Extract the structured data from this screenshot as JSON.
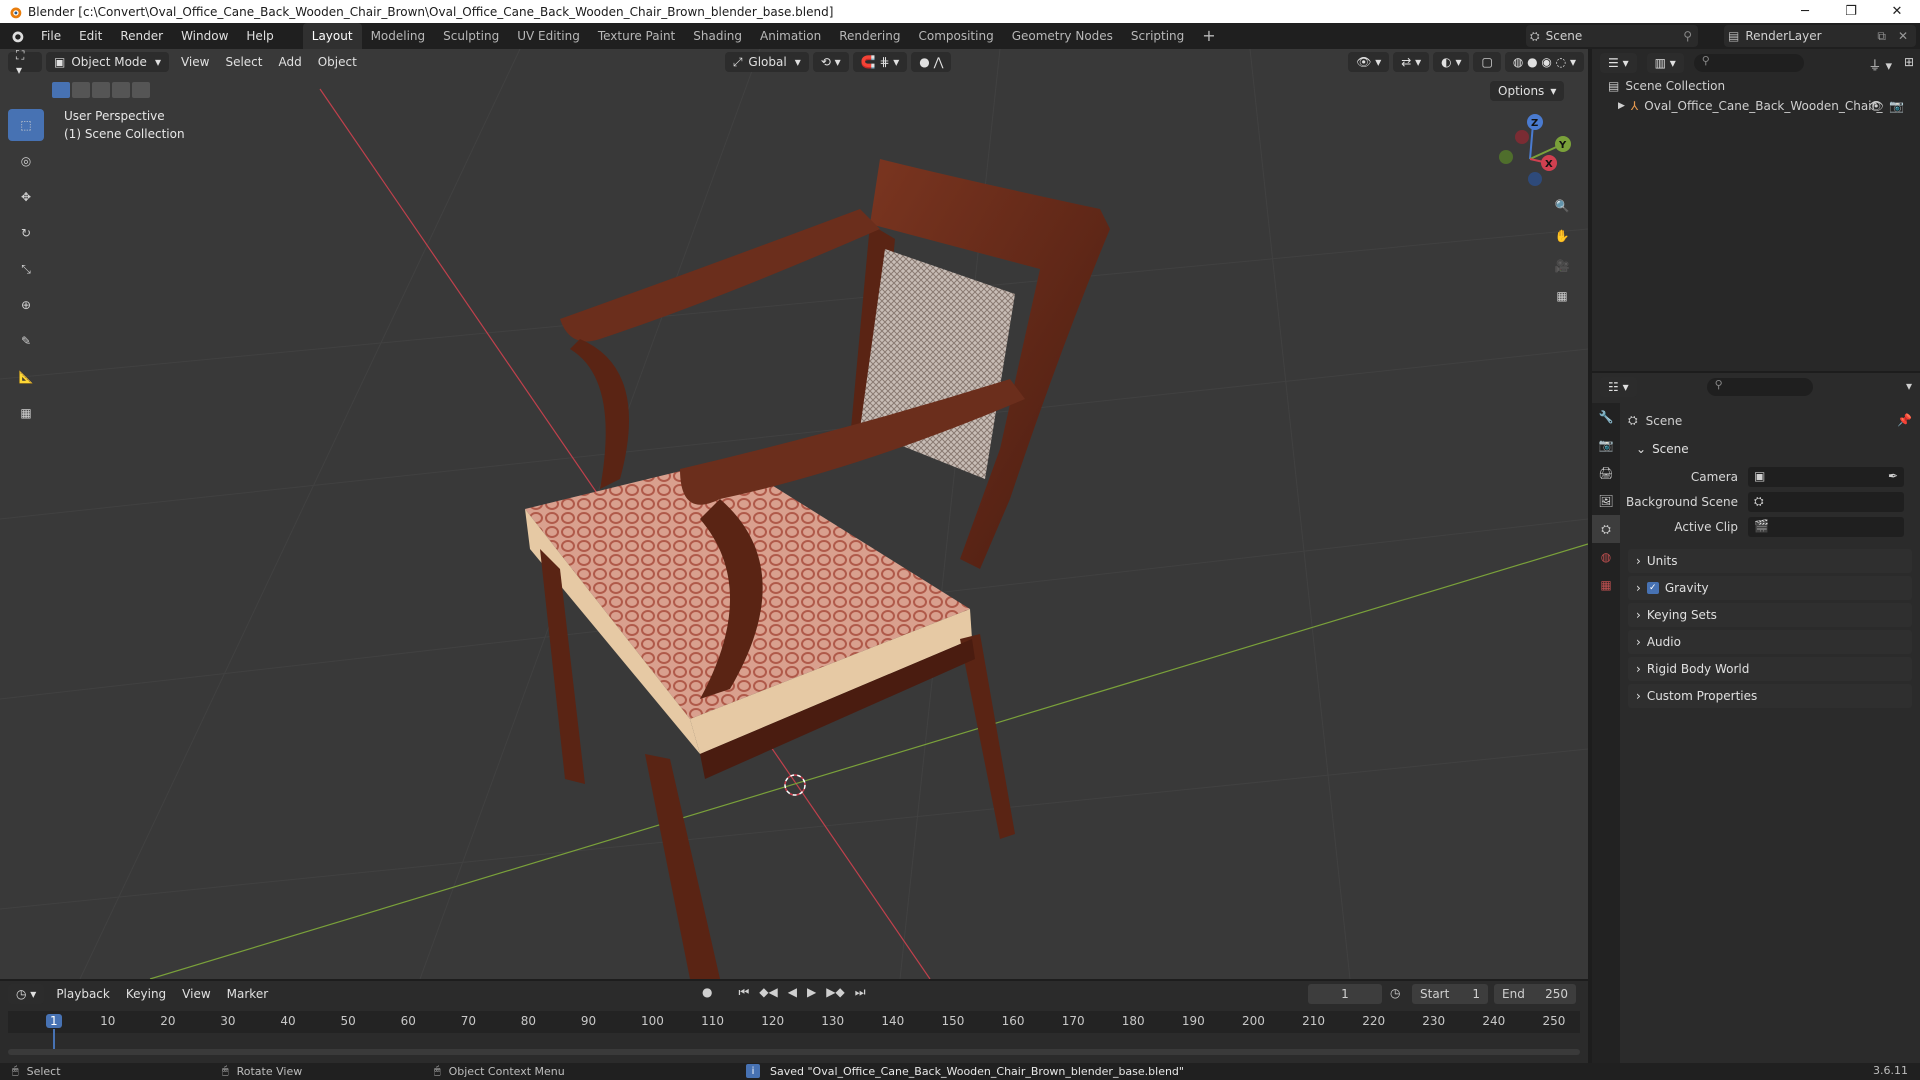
{
  "window": {
    "title": "Blender [c:\\Convert\\Oval_Office_Cane_Back_Wooden_Chair_Brown\\Oval_Office_Cane_Back_Wooden_Chair_Brown_blender_base.blend]"
  },
  "menu": [
    "File",
    "Edit",
    "Render",
    "Window",
    "Help"
  ],
  "workspaces": [
    "Layout",
    "Modeling",
    "Sculpting",
    "UV Editing",
    "Texture Paint",
    "Shading",
    "Animation",
    "Rendering",
    "Compositing",
    "Geometry Nodes",
    "Scripting"
  ],
  "active_workspace": "Layout",
  "scene_name": "Scene",
  "render_layer": "RenderLayer",
  "viewport": {
    "mode": "Object Mode",
    "menus": [
      "View",
      "Select",
      "Add",
      "Object"
    ],
    "transform_orientation": "Global",
    "options_label": "Options",
    "perspective_label": "User Perspective",
    "collection_label": "(1) Scene Collection"
  },
  "outliner": {
    "root": "Scene Collection",
    "object": "Oval_Office_Cane_Back_Wooden_Chair_"
  },
  "properties": {
    "header": "Scene",
    "panel_title": "Scene",
    "fields": [
      {
        "label": "Camera"
      },
      {
        "label": "Background Scene"
      },
      {
        "label": "Active Clip"
      }
    ],
    "sections": [
      "Units",
      "Gravity",
      "Keying Sets",
      "Audio",
      "Rigid Body World",
      "Custom Properties"
    ],
    "gravity_checked": true,
    "version": "3.6.11"
  },
  "timeline": {
    "menus": [
      "Playback",
      "Keying",
      "View",
      "Marker"
    ],
    "current_frame": "1",
    "start_label": "Start",
    "start": "1",
    "end_label": "End",
    "end": "250",
    "ticks": [
      "1",
      "10",
      "20",
      "30",
      "40",
      "50",
      "60",
      "70",
      "80",
      "90",
      "100",
      "110",
      "120",
      "130",
      "140",
      "150",
      "160",
      "170",
      "180",
      "190",
      "200",
      "210",
      "220",
      "230",
      "240",
      "250"
    ]
  },
  "status": {
    "select": "Select",
    "rotate": "Rotate View",
    "context": "Object Context Menu",
    "message": "Saved \"Oval_Office_Cane_Back_Wooden_Chair_Brown_blender_base.blend\""
  },
  "colors": {
    "accent": "#4772b3",
    "x_axis": "#d04050",
    "y_axis": "#7aa13a",
    "wood": "#6b2e1c",
    "cushion": "#d99a88"
  }
}
